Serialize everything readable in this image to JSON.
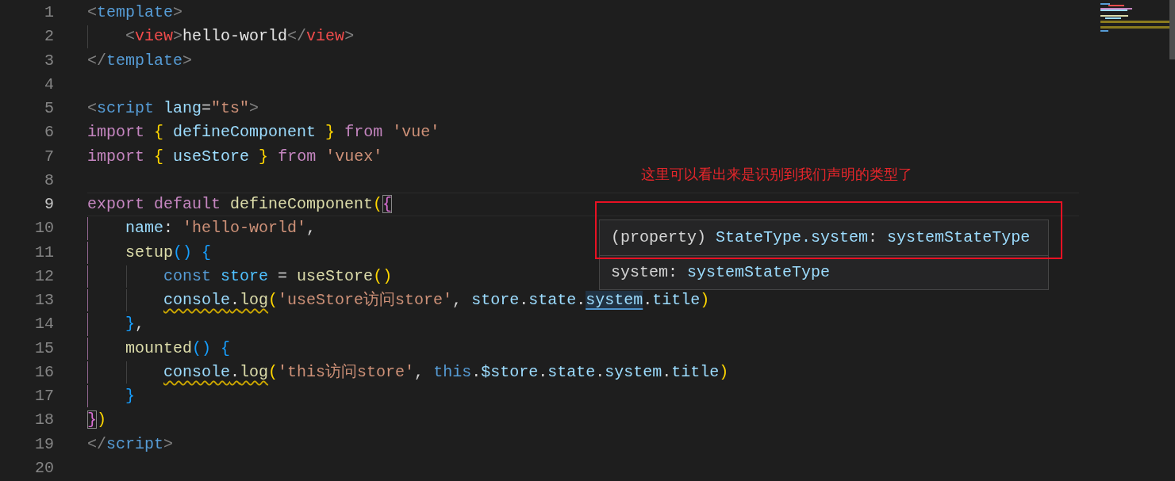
{
  "editor": {
    "lines": [
      {
        "number": "1",
        "current": false,
        "active_guide": false,
        "tokens": [
          {
            "text": "<",
            "kind": "punct"
          },
          {
            "text": "template",
            "kind": "tag"
          },
          {
            "text": ">",
            "kind": "punct"
          }
        ]
      },
      {
        "number": "2",
        "current": false,
        "active_guide": false,
        "tokens": [
          {
            "text": "    <",
            "kind": "punct"
          },
          {
            "text": "view",
            "kind": "customtag"
          },
          {
            "text": ">",
            "kind": "punct"
          },
          {
            "text": "hello-world",
            "kind": "text"
          },
          {
            "text": "</",
            "kind": "punct"
          },
          {
            "text": "view",
            "kind": "customtag"
          },
          {
            "text": ">",
            "kind": "punct"
          }
        ]
      },
      {
        "number": "3",
        "current": false,
        "active_guide": false,
        "tokens": [
          {
            "text": "</",
            "kind": "punct"
          },
          {
            "text": "template",
            "kind": "tag"
          },
          {
            "text": ">",
            "kind": "punct"
          }
        ]
      },
      {
        "number": "4",
        "current": false,
        "active_guide": false
      },
      {
        "number": "5",
        "current": false,
        "active_guide": false,
        "tokens": [
          {
            "text": "<",
            "kind": "punct"
          },
          {
            "text": "script",
            "kind": "tag"
          },
          {
            "text": " lang",
            "kind": "attr"
          },
          {
            "text": "=",
            "kind": "plain"
          },
          {
            "text": "\"ts\"",
            "kind": "string"
          },
          {
            "text": ">",
            "kind": "punct"
          }
        ]
      },
      {
        "number": "6",
        "current": false,
        "active_guide": false,
        "tokens": [
          {
            "text": "import",
            "kind": "keyword"
          },
          {
            "text": " {",
            "kind": "bracket1"
          },
          {
            "text": " defineComponent",
            "kind": "var"
          },
          {
            "text": " }",
            "kind": "bracket1"
          },
          {
            "text": " from",
            "kind": "keyword"
          },
          {
            "text": " 'vue'",
            "kind": "string"
          }
        ]
      },
      {
        "number": "7",
        "current": false,
        "active_guide": false,
        "tokens": [
          {
            "text": "import",
            "kind": "keyword"
          },
          {
            "text": " {",
            "kind": "bracket1"
          },
          {
            "text": " useStore",
            "kind": "var"
          },
          {
            "text": " }",
            "kind": "bracket1"
          },
          {
            "text": " from",
            "kind": "keyword"
          },
          {
            "text": " 'vuex'",
            "kind": "string"
          }
        ]
      },
      {
        "number": "8",
        "current": false,
        "active_guide": false
      },
      {
        "number": "9",
        "current": true,
        "active_guide": false,
        "tokens": [
          {
            "text": "export",
            "kind": "keyword"
          },
          {
            "text": " default",
            "kind": "keyword"
          },
          {
            "text": " defineComponent",
            "kind": "func"
          },
          {
            "text": "(",
            "kind": "bracket1"
          },
          {
            "text": "{",
            "kind": "bracket2",
            "matched": true
          }
        ]
      },
      {
        "number": "10",
        "current": false,
        "active_guide": true,
        "tokens": [
          {
            "text": "    name",
            "kind": "var"
          },
          {
            "text": ":",
            "kind": "plain"
          },
          {
            "text": " 'hello-world'",
            "kind": "string"
          },
          {
            "text": ",",
            "kind": "plain"
          }
        ]
      },
      {
        "number": "11",
        "current": false,
        "active_guide": true,
        "tokens": [
          {
            "text": "    setup",
            "kind": "func"
          },
          {
            "text": "()",
            "kind": "bracket3"
          },
          {
            "text": " {",
            "kind": "bracket3"
          }
        ]
      },
      {
        "number": "12",
        "current": false,
        "active_guide": true,
        "tokens": [
          {
            "text": "        const",
            "kind": "storage"
          },
          {
            "text": " store",
            "kind": "const"
          },
          {
            "text": " =",
            "kind": "plain"
          },
          {
            "text": " useStore",
            "kind": "func"
          },
          {
            "text": "()",
            "kind": "bracket1"
          }
        ]
      },
      {
        "number": "13",
        "current": false,
        "active_guide": true,
        "tokens": [
          {
            "text": "        console",
            "kind": "var",
            "warning": true
          },
          {
            "text": ".",
            "kind": "plain",
            "warning": true
          },
          {
            "text": "log",
            "kind": "func",
            "warning": true
          },
          {
            "text": "(",
            "kind": "bracket1"
          },
          {
            "text": "'useStore访问store'",
            "kind": "string"
          },
          {
            "text": ",",
            "kind": "plain"
          },
          {
            "text": " store",
            "kind": "var"
          },
          {
            "text": ".",
            "kind": "plain"
          },
          {
            "text": "state",
            "kind": "var"
          },
          {
            "text": ".",
            "kind": "plain"
          },
          {
            "text": "system",
            "kind": "var",
            "hovered": true
          },
          {
            "text": ".",
            "kind": "plain"
          },
          {
            "text": "title",
            "kind": "var"
          },
          {
            "text": ")",
            "kind": "bracket1"
          }
        ]
      },
      {
        "number": "14",
        "current": false,
        "active_guide": true,
        "tokens": [
          {
            "text": "    }",
            "kind": "bracket3"
          },
          {
            "text": ",",
            "kind": "plain"
          }
        ]
      },
      {
        "number": "15",
        "current": false,
        "active_guide": true,
        "tokens": [
          {
            "text": "    mounted",
            "kind": "func"
          },
          {
            "text": "()",
            "kind": "bracket3"
          },
          {
            "text": " {",
            "kind": "bracket3"
          }
        ]
      },
      {
        "number": "16",
        "current": false,
        "active_guide": true,
        "tokens": [
          {
            "text": "        console",
            "kind": "var",
            "warning": true
          },
          {
            "text": ".",
            "kind": "plain",
            "warning": true
          },
          {
            "text": "log",
            "kind": "func",
            "warning": true
          },
          {
            "text": "(",
            "kind": "bracket1"
          },
          {
            "text": "'this访问store'",
            "kind": "string"
          },
          {
            "text": ",",
            "kind": "plain"
          },
          {
            "text": " this",
            "kind": "storage"
          },
          {
            "text": ".",
            "kind": "plain"
          },
          {
            "text": "$store",
            "kind": "var"
          },
          {
            "text": ".",
            "kind": "plain"
          },
          {
            "text": "state",
            "kind": "var"
          },
          {
            "text": ".",
            "kind": "plain"
          },
          {
            "text": "system",
            "kind": "var"
          },
          {
            "text": ".",
            "kind": "plain"
          },
          {
            "text": "title",
            "kind": "var"
          },
          {
            "text": ")",
            "kind": "bracket1"
          }
        ]
      },
      {
        "number": "17",
        "current": false,
        "active_guide": true,
        "tokens": [
          {
            "text": "    }",
            "kind": "bracket3"
          }
        ]
      },
      {
        "number": "18",
        "current": false,
        "active_guide": false,
        "tokens": [
          {
            "text": "}",
            "kind": "bracket2",
            "matched": true
          },
          {
            "text": ")",
            "kind": "bracket1"
          }
        ]
      },
      {
        "number": "19",
        "current": false,
        "active_guide": false,
        "tokens": [
          {
            "text": "</",
            "kind": "punct"
          },
          {
            "text": "script",
            "kind": "tag"
          },
          {
            "text": ">",
            "kind": "punct"
          }
        ]
      },
      {
        "number": "20",
        "current": false,
        "active_guide": false
      }
    ]
  },
  "annotation": {
    "text": "这里可以看出来是识别到我们声明的类型了"
  },
  "hover": {
    "signature": [
      {
        "text": "(property)",
        "kind": "plain"
      },
      {
        "text": " StateType.system",
        "kind": "var"
      },
      {
        "text": ":",
        "kind": "plain"
      },
      {
        "text": " systemStateType",
        "kind": "var"
      }
    ],
    "documentation": [
      {
        "text": "system",
        "kind": "plain"
      },
      {
        "text": ":",
        "kind": "plain"
      },
      {
        "text": " systemStateType",
        "kind": "var"
      }
    ]
  }
}
